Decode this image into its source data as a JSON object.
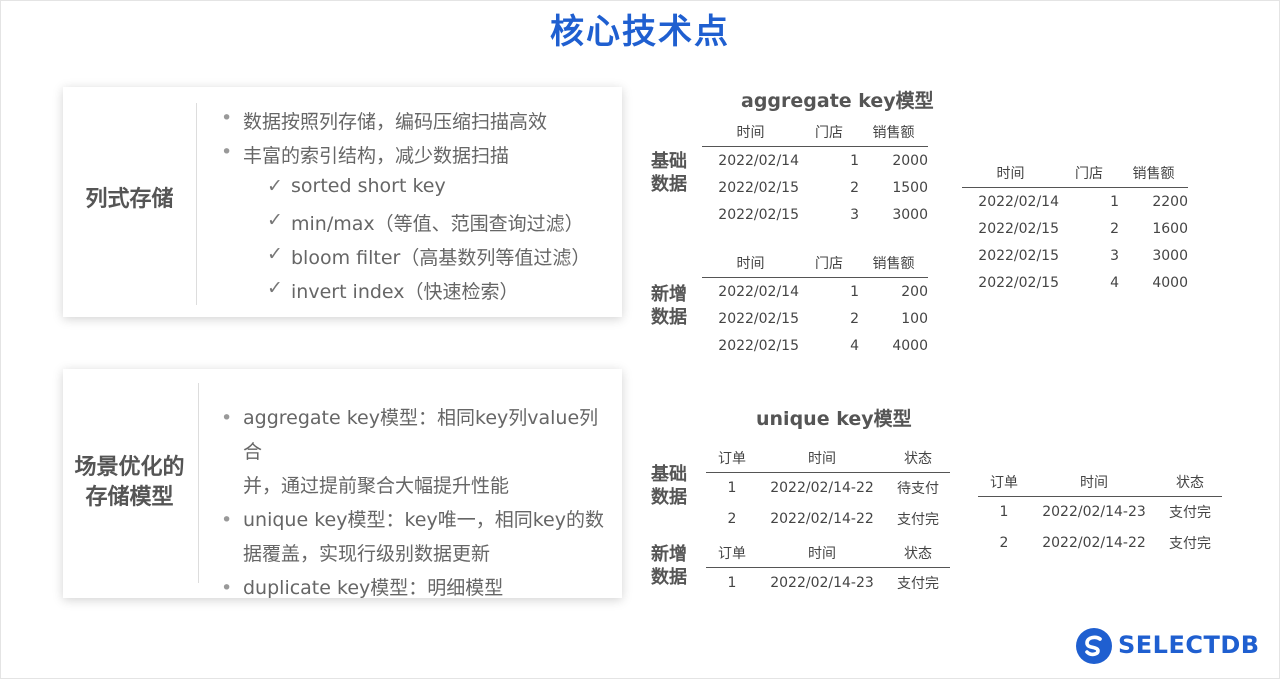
{
  "page": {
    "title": "核心技术点"
  },
  "cards": {
    "columnar": {
      "label": "列式存储",
      "items": [
        {
          "type": "bullet",
          "text": "数据按照列存储，编码压缩扫描高效"
        },
        {
          "type": "bullet",
          "text": "丰富的索引结构，减少数据扫描"
        },
        {
          "type": "check",
          "text": "sorted short key"
        },
        {
          "type": "check",
          "text": "min/max（等值、范围查询过滤）"
        },
        {
          "type": "check",
          "text": "bloom filter（高基数列等值过滤）"
        },
        {
          "type": "check",
          "text": "invert index（快速检索）"
        }
      ]
    },
    "scenario": {
      "label_line1": "场景优化的",
      "label_line2": "存储模型",
      "items": [
        {
          "line1": "aggregate key模型：相同key列value列合",
          "line2": "并，通过提前聚合大幅提升性能"
        },
        {
          "line1": "unique key模型：key唯一，相同key的数",
          "line2": "据覆盖，实现行级别数据更新"
        },
        {
          "line1": "duplicate key模型：明细模型",
          "line2": ""
        }
      ]
    }
  },
  "aggregate": {
    "heading": "aggregate key模型",
    "base_label": [
      "基础",
      "数据"
    ],
    "new_label": [
      "新增",
      "数据"
    ],
    "headers": [
      "时间",
      "门店",
      "销售额"
    ],
    "base_rows": [
      [
        "2022/02/14",
        "1",
        "2000"
      ],
      [
        "2022/02/15",
        "2",
        "1500"
      ],
      [
        "2022/02/15",
        "3",
        "3000"
      ]
    ],
    "new_rows": [
      [
        "2022/02/14",
        "1",
        "200"
      ],
      [
        "2022/02/15",
        "2",
        "100"
      ],
      [
        "2022/02/15",
        "4",
        "4000"
      ]
    ],
    "result_rows": [
      [
        "2022/02/14",
        "1",
        "2200"
      ],
      [
        "2022/02/15",
        "2",
        "1600"
      ],
      [
        "2022/02/15",
        "3",
        "3000"
      ],
      [
        "2022/02/15",
        "4",
        "4000"
      ]
    ]
  },
  "unique": {
    "heading": "unique key模型",
    "base_label": [
      "基础",
      "数据"
    ],
    "new_label": [
      "新增",
      "数据"
    ],
    "headers": [
      "订单",
      "时间",
      "状态"
    ],
    "base_rows": [
      [
        "1",
        "2022/02/14-22",
        "待支付"
      ],
      [
        "2",
        "2022/02/14-22",
        "支付完"
      ]
    ],
    "new_rows": [
      [
        "1",
        "2022/02/14-23",
        "支付完"
      ]
    ],
    "result_rows": [
      [
        "1",
        "2022/02/14-23",
        "支付完"
      ],
      [
        "2",
        "2022/02/14-22",
        "支付完"
      ]
    ]
  },
  "brand": {
    "name": "SELECTDB",
    "logo_icon": "selectdb-logo-icon",
    "color": "#1f5fd0"
  }
}
